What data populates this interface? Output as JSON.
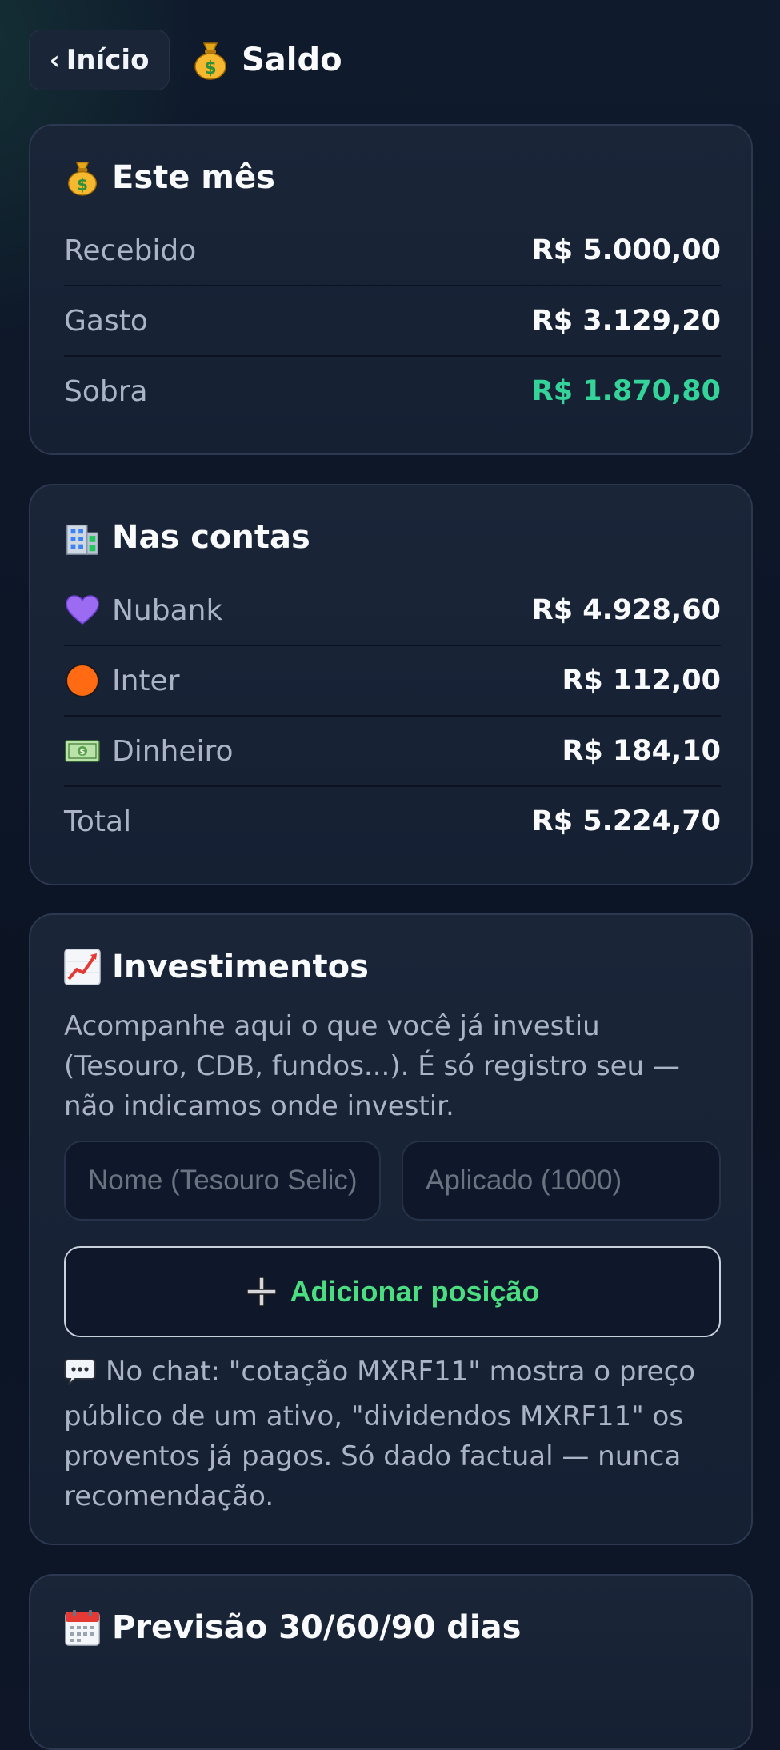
{
  "header": {
    "back_label": "Início",
    "title": "Saldo",
    "title_icon": "money-bag-icon"
  },
  "month_card": {
    "title": "Este mês",
    "title_icon": "money-bag-icon",
    "rows": [
      {
        "label": "Recebido",
        "value": "R$ 5.000,00"
      },
      {
        "label": "Gasto",
        "value": "R$ 3.129,20"
      },
      {
        "label": "Sobra",
        "value": "R$ 1.870,80",
        "color": "#34d399"
      }
    ]
  },
  "accounts_card": {
    "title": "Nas contas",
    "title_icon": "bank-building-icon",
    "rows": [
      {
        "icon": "purple-heart-icon",
        "label": "Nubank",
        "value": "R$ 4.928,60"
      },
      {
        "icon": "orange-circle-icon",
        "label": "Inter",
        "value": "R$ 112,00"
      },
      {
        "icon": "dollar-banknote-icon",
        "label": "Dinheiro",
        "value": "R$ 184,10"
      },
      {
        "label": "Total",
        "value": "R$ 5.224,70"
      }
    ]
  },
  "investments_card": {
    "title": "Investimentos",
    "title_icon": "chart-increasing-icon",
    "description": "Acompanhe aqui o que você já investiu (Tesouro, CDB, fundos...). É só registro seu — não indicamos onde investir.",
    "name_placeholder": "Nome (Tesouro Selic)",
    "amount_placeholder": "Aplicado (1000)",
    "add_button_label": "Adicionar posição",
    "chat_note": "No chat: \"cotação MXRF11\" mostra o preço público de um ativo, \"dividendos MXRF11\" os proventos já pagos. Só dado factual — nunca recomendação."
  },
  "forecast_card": {
    "title": "Previsão 30/60/90 dias",
    "title_icon": "calendar-icon"
  },
  "colors": {
    "background": "#0e1628",
    "card": "#1a2538",
    "positive": "#34d399",
    "accent_green": "#4ade80"
  }
}
